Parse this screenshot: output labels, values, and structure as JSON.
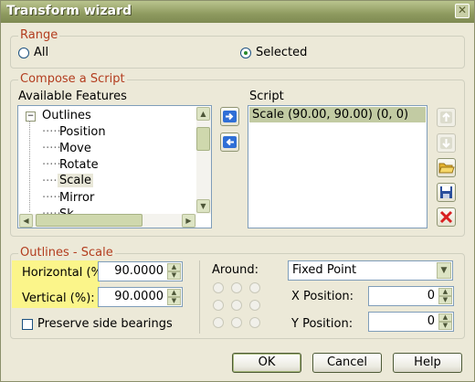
{
  "window": {
    "title": "Transform wizard",
    "close_glyph": "✕"
  },
  "range": {
    "legend": "Range",
    "options": [
      {
        "label": "All",
        "selected": false
      },
      {
        "label": "Selected",
        "selected": true
      }
    ]
  },
  "compose": {
    "legend": "Compose a Script",
    "available_label": "Available Features",
    "tree": {
      "root": "Outlines",
      "expander": "−",
      "children": [
        "Position",
        "Move",
        "Rotate",
        "Scale",
        "Mirror",
        "Sk"
      ],
      "selected": "Scale"
    },
    "script_label": "Script",
    "script_items": [
      "Scale (90.00, 90.00) (0, 0)"
    ],
    "buttons": {
      "add": "arrow-right-icon",
      "remove": "arrow-left-icon",
      "up": "arrow-up-icon",
      "down": "arrow-down-icon",
      "open": "folder-open-icon",
      "save": "floppy-disk-icon",
      "delete": "red-x-icon"
    }
  },
  "params": {
    "legend": "Outlines - Scale",
    "horizontal_label": "Horizontal (%",
    "horizontal_value": "90.0000",
    "vertical_label": "Vertical (%):",
    "vertical_value": "90.0000",
    "preserve_label": "Preserve side bearings",
    "preserve_checked": false,
    "around_label": "Around:",
    "around_value": "Fixed Point",
    "x_label": "X Position:",
    "x_value": "0",
    "y_label": "Y Position:",
    "y_value": "0"
  },
  "footer": {
    "ok": "OK",
    "cancel": "Cancel",
    "help": "Help"
  },
  "colors": {
    "accent_title": "#b33d1f",
    "highlight": "#fbf58a",
    "selection": "#c2cba3"
  }
}
